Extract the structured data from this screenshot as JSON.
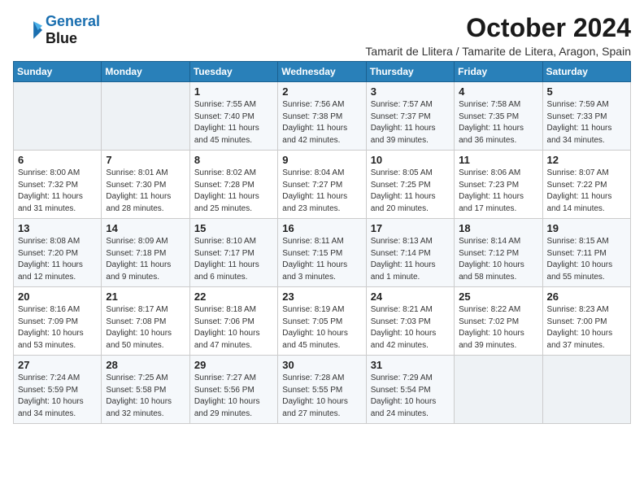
{
  "logo": {
    "line1": "General",
    "line2": "Blue"
  },
  "title": "October 2024",
  "location": "Tamarit de Llitera / Tamarite de Litera, Aragon, Spain",
  "days_of_week": [
    "Sunday",
    "Monday",
    "Tuesday",
    "Wednesday",
    "Thursday",
    "Friday",
    "Saturday"
  ],
  "weeks": [
    [
      {
        "day": null
      },
      {
        "day": null
      },
      {
        "day": "1",
        "sunrise": "7:55 AM",
        "sunset": "7:40 PM",
        "daylight": "11 hours and 45 minutes."
      },
      {
        "day": "2",
        "sunrise": "7:56 AM",
        "sunset": "7:38 PM",
        "daylight": "11 hours and 42 minutes."
      },
      {
        "day": "3",
        "sunrise": "7:57 AM",
        "sunset": "7:37 PM",
        "daylight": "11 hours and 39 minutes."
      },
      {
        "day": "4",
        "sunrise": "7:58 AM",
        "sunset": "7:35 PM",
        "daylight": "11 hours and 36 minutes."
      },
      {
        "day": "5",
        "sunrise": "7:59 AM",
        "sunset": "7:33 PM",
        "daylight": "11 hours and 34 minutes."
      }
    ],
    [
      {
        "day": "6",
        "sunrise": "8:00 AM",
        "sunset": "7:32 PM",
        "daylight": "11 hours and 31 minutes."
      },
      {
        "day": "7",
        "sunrise": "8:01 AM",
        "sunset": "7:30 PM",
        "daylight": "11 hours and 28 minutes."
      },
      {
        "day": "8",
        "sunrise": "8:02 AM",
        "sunset": "7:28 PM",
        "daylight": "11 hours and 25 minutes."
      },
      {
        "day": "9",
        "sunrise": "8:04 AM",
        "sunset": "7:27 PM",
        "daylight": "11 hours and 23 minutes."
      },
      {
        "day": "10",
        "sunrise": "8:05 AM",
        "sunset": "7:25 PM",
        "daylight": "11 hours and 20 minutes."
      },
      {
        "day": "11",
        "sunrise": "8:06 AM",
        "sunset": "7:23 PM",
        "daylight": "11 hours and 17 minutes."
      },
      {
        "day": "12",
        "sunrise": "8:07 AM",
        "sunset": "7:22 PM",
        "daylight": "11 hours and 14 minutes."
      }
    ],
    [
      {
        "day": "13",
        "sunrise": "8:08 AM",
        "sunset": "7:20 PM",
        "daylight": "11 hours and 12 minutes."
      },
      {
        "day": "14",
        "sunrise": "8:09 AM",
        "sunset": "7:18 PM",
        "daylight": "11 hours and 9 minutes."
      },
      {
        "day": "15",
        "sunrise": "8:10 AM",
        "sunset": "7:17 PM",
        "daylight": "11 hours and 6 minutes."
      },
      {
        "day": "16",
        "sunrise": "8:11 AM",
        "sunset": "7:15 PM",
        "daylight": "11 hours and 3 minutes."
      },
      {
        "day": "17",
        "sunrise": "8:13 AM",
        "sunset": "7:14 PM",
        "daylight": "11 hours and 1 minute."
      },
      {
        "day": "18",
        "sunrise": "8:14 AM",
        "sunset": "7:12 PM",
        "daylight": "10 hours and 58 minutes."
      },
      {
        "day": "19",
        "sunrise": "8:15 AM",
        "sunset": "7:11 PM",
        "daylight": "10 hours and 55 minutes."
      }
    ],
    [
      {
        "day": "20",
        "sunrise": "8:16 AM",
        "sunset": "7:09 PM",
        "daylight": "10 hours and 53 minutes."
      },
      {
        "day": "21",
        "sunrise": "8:17 AM",
        "sunset": "7:08 PM",
        "daylight": "10 hours and 50 minutes."
      },
      {
        "day": "22",
        "sunrise": "8:18 AM",
        "sunset": "7:06 PM",
        "daylight": "10 hours and 47 minutes."
      },
      {
        "day": "23",
        "sunrise": "8:19 AM",
        "sunset": "7:05 PM",
        "daylight": "10 hours and 45 minutes."
      },
      {
        "day": "24",
        "sunrise": "8:21 AM",
        "sunset": "7:03 PM",
        "daylight": "10 hours and 42 minutes."
      },
      {
        "day": "25",
        "sunrise": "8:22 AM",
        "sunset": "7:02 PM",
        "daylight": "10 hours and 39 minutes."
      },
      {
        "day": "26",
        "sunrise": "8:23 AM",
        "sunset": "7:00 PM",
        "daylight": "10 hours and 37 minutes."
      }
    ],
    [
      {
        "day": "27",
        "sunrise": "7:24 AM",
        "sunset": "5:59 PM",
        "daylight": "10 hours and 34 minutes."
      },
      {
        "day": "28",
        "sunrise": "7:25 AM",
        "sunset": "5:58 PM",
        "daylight": "10 hours and 32 minutes."
      },
      {
        "day": "29",
        "sunrise": "7:27 AM",
        "sunset": "5:56 PM",
        "daylight": "10 hours and 29 minutes."
      },
      {
        "day": "30",
        "sunrise": "7:28 AM",
        "sunset": "5:55 PM",
        "daylight": "10 hours and 27 minutes."
      },
      {
        "day": "31",
        "sunrise": "7:29 AM",
        "sunset": "5:54 PM",
        "daylight": "10 hours and 24 minutes."
      },
      {
        "day": null
      },
      {
        "day": null
      }
    ]
  ]
}
